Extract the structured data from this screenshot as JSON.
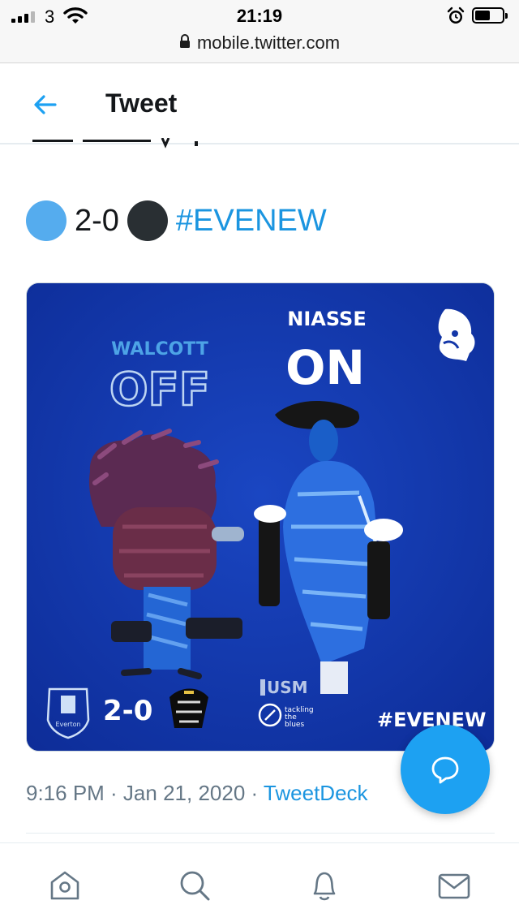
{
  "status_bar": {
    "carrier": "3",
    "time": "21:19",
    "url": "mobile.twitter.com"
  },
  "header": {
    "title": "Tweet"
  },
  "tweet": {
    "score": "2-0",
    "hashtag": "#EVENEW",
    "timestamp": "9:16 PM · Jan 21, 2020 · ",
    "source": "TweetDeck"
  },
  "media": {
    "player_off_name": "WALCOTT",
    "off_label": "OFF",
    "player_on_name": "NIASSE",
    "on_label": "ON",
    "score": "2-0",
    "sponsor_short": "USM",
    "charity_line1": "tackling",
    "charity_line2": "the",
    "charity_line3": "blues",
    "hashtag": "#EVENEW",
    "home_club_text": "Everton"
  },
  "colors": {
    "twitter_blue": "#1da1f2",
    "link_blue": "#1b95e0",
    "card_blue": "#1437a8",
    "everton_blue": "#55acee",
    "newcastle_dark": "#292f33"
  },
  "icons": {
    "back": "arrow-left-icon",
    "compose": "reply-bubble-icon",
    "nav": [
      "home-icon",
      "search-icon",
      "bell-icon",
      "mail-icon"
    ]
  }
}
